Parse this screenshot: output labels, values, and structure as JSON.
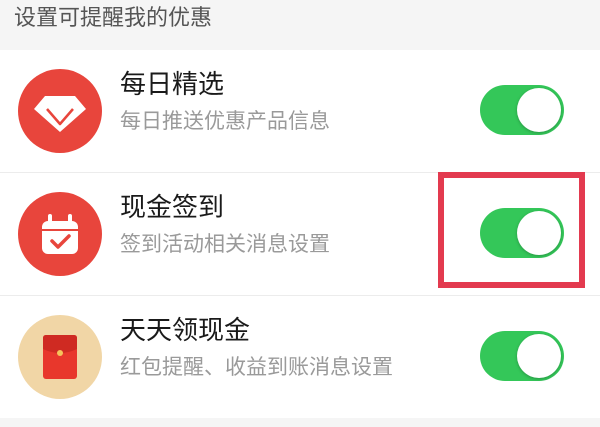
{
  "header": {
    "title": "设置可提醒我的优惠"
  },
  "settings": [
    {
      "title": "每日精选",
      "subtitle": "每日推送优惠产品信息",
      "icon": "diamond-icon",
      "icon_bg": "#e8453c",
      "enabled": true
    },
    {
      "title": "现金签到",
      "subtitle": "签到活动相关消息设置",
      "icon": "calendar-check-icon",
      "icon_bg": "#e8453c",
      "enabled": true
    },
    {
      "title": "天天领现金",
      "subtitle": "红包提醒、收益到账消息设置",
      "icon": "red-envelope-icon",
      "icon_bg": "#f1d6a6",
      "enabled": true
    }
  ],
  "colors": {
    "toggle_on": "#34c759",
    "toggle_off": "#e5e5e5",
    "highlight": "#e33a4f",
    "background": "#f5f5f5"
  }
}
